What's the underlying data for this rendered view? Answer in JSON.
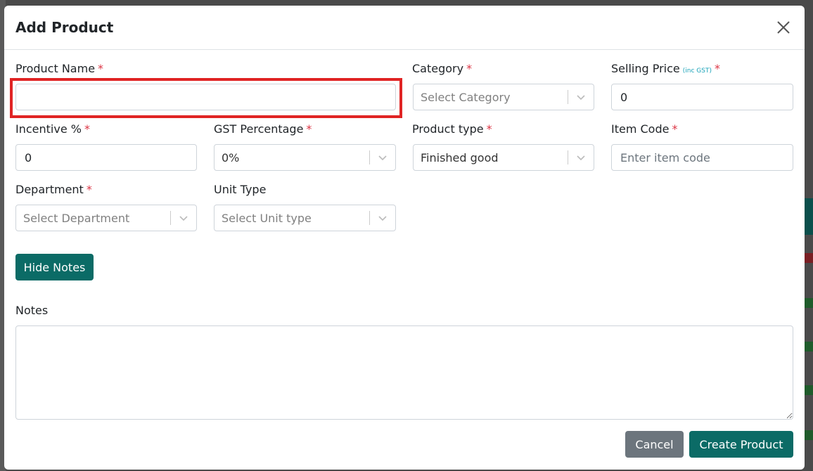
{
  "modal": {
    "title": "Add Product"
  },
  "fields": {
    "product_name": {
      "label": "Product Name",
      "required": "*",
      "value": "",
      "placeholder": ""
    },
    "category": {
      "label": "Category",
      "required": "*",
      "value": "Select Category"
    },
    "selling_price": {
      "label": "Selling Price",
      "sublabel": "(inc GST)",
      "required": "*",
      "value": "0"
    },
    "incentive": {
      "label": "Incentive %",
      "required": "*",
      "value": "0"
    },
    "gst_percentage": {
      "label": "GST Percentage",
      "required": "*",
      "value": "0%"
    },
    "product_type": {
      "label": "Product type",
      "required": "*",
      "value": "Finished good"
    },
    "item_code": {
      "label": "Item Code",
      "required": "*",
      "value": "",
      "placeholder": "Enter item code"
    },
    "department": {
      "label": "Department",
      "required": "*",
      "value": "Select Department"
    },
    "unit_type": {
      "label": "Unit Type",
      "value": "Select Unit type"
    },
    "notes": {
      "label": "Notes",
      "value": ""
    }
  },
  "buttons": {
    "hide_notes": "Hide Notes",
    "cancel": "Cancel",
    "create": "Create Product"
  },
  "colors": {
    "primary": "#0b6b66",
    "secondary": "#6c757d",
    "required": "#dc3545",
    "highlight": "#e02424",
    "sublabel": "#17a2b8"
  },
  "icons": {
    "close": "close-icon",
    "chevron": "chevron-down-icon",
    "resize": "resize-grip-icon"
  }
}
